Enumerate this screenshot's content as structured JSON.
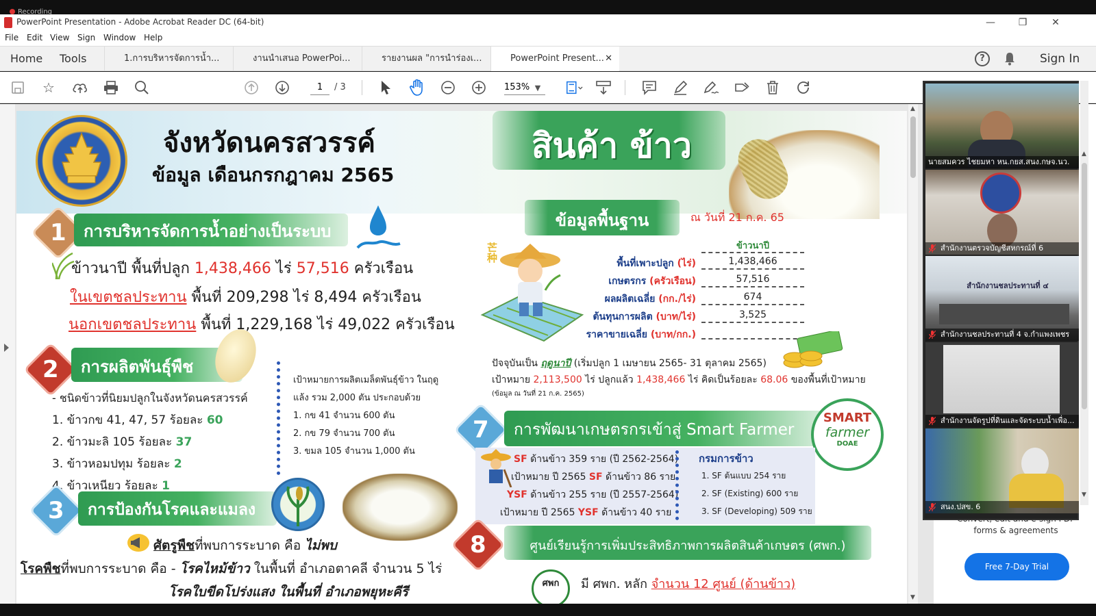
{
  "recording": "Recording",
  "window": {
    "title": "PowerPoint Presentation - Adobe Acrobat Reader DC (64-bit)",
    "minimize": "—",
    "restore": "❐",
    "close": "✕"
  },
  "menu": [
    "File",
    "Edit",
    "View",
    "Sign",
    "Window",
    "Help"
  ],
  "nav": {
    "home": "Home",
    "tools": "Tools",
    "sign_in": "Sign In",
    "help": "?"
  },
  "tabs": [
    {
      "label": "1.การบริหารจัดการน้ำ..."
    },
    {
      "label": "งานนำเสนอ PowerPoi..."
    },
    {
      "label": "รายงานผล \"การนำร่องเ..."
    },
    {
      "label": "PowerPoint Present...",
      "close": "✕"
    }
  ],
  "toolbar": {
    "page_current": "1",
    "page_total": "/ 3",
    "zoom": "153%"
  },
  "icons": {
    "save": "save-icon",
    "bookmark": "star-icon",
    "upload": "upload-icon",
    "print": "print-icon",
    "search": "search-icon",
    "prev": "prev-page-icon",
    "next": "next-page-icon",
    "select": "cursor-icon",
    "hand": "hand-icon",
    "zoom_out": "zoom-out-icon",
    "zoom_in": "zoom-in-icon",
    "fit": "fit-page-icon",
    "scroll": "scroll-mode-icon",
    "comment": "comment-icon",
    "highlight": "pen-icon",
    "sign": "sign-icon",
    "stamp": "stamp-icon",
    "delete": "trash-icon",
    "rotate": "rotate-icon"
  },
  "slide": {
    "province": "จังหวัดนครสวรรค์",
    "data_month": "ข้อมูล เดือนกรกฎาคม 2565",
    "product_title": "สินค้า  ข้าว",
    "sec1": {
      "num": "1",
      "title": "การบริหารจัดการน้ำอย่างเป็นระบบ",
      "line1_a": "ข้าวนาปี พื้นที่ปลูก ",
      "line1_b": "1,438,466",
      "line1_c": " ไร่ ",
      "line1_d": "57,516",
      "line1_e": " ครัวเรือน",
      "line2_a": "ในเขตชลประทาน",
      "line2_b": " พื้นที่ 209,298 ไร่ 8,494 ครัวเรือน",
      "line3_a": "นอกเขตชลประทาน",
      "line3_b": " พื้นที่ 1,229,168 ไร่ 49,022 ครัวเรือน"
    },
    "sec2": {
      "num": "2",
      "title": "การผลิตพันธุ์พืช",
      "intro": "- ชนิดข้าวที่นิยมปลูกในจังหวัดนครสวรรค์",
      "items": [
        {
          "label": "1. ข้าวกข 41, 47, 57  ร้อยละ ",
          "pct": "60"
        },
        {
          "label": "2. ข้าวมะลิ 105      ร้อยละ ",
          "pct": "37"
        },
        {
          "label": "3. ข้าวหอมปทุม      ร้อยละ ",
          "pct": "2"
        },
        {
          "label": "4. ข้าวเหนียว  ร้อยละ ",
          "pct": "1"
        }
      ],
      "target_l1": "เป้าหมายการผลิตเมล็ดพันธุ์ข้าว ในฤดู",
      "target_l2": "แล้ง รวม 2,000 ตัน ประกอบด้วย",
      "target_items": [
        "1. กข 41 จำนวน 600 ตัน",
        "2. กข 79 จำนวน  700 ตัน",
        "3. ขมล 105 จำนวน 1,000 ตัน"
      ]
    },
    "sec3": {
      "num": "3",
      "title": "การป้องกันโรคและแมลง",
      "pest_a": "ศัตรูพืช",
      "pest_b": "ที่พบการระบาด คือ ",
      "pest_c": "ไม่พบ",
      "disease_a": "โรคพืช",
      "disease_b": "ที่พบการระบาด คือ - ",
      "disease_c": "โรคไหม้ข้าว",
      "disease_d": " ในพื้นที่ อำเภอตาคลี จำนวน 5 ไร่",
      "disease2": "โรคใบขีดโปร่งแสง ในพื้นที่ อำเภอพยุหะคีรี"
    },
    "basic": {
      "title": "ข้อมูลพื้นฐาน",
      "as_of": "ณ วันที่ 21 ก.ค. 65",
      "col_header": "ข้าวนาปี",
      "rows": [
        {
          "a": "พื้นที่เพาะปลูก ",
          "u": "(ไร่)",
          "value": "1,438,466"
        },
        {
          "a": "เกษตรกร ",
          "u": "(ครัวเรือน)",
          "value": "57,516"
        },
        {
          "a": "ผลผลิตเฉลี่ย ",
          "u": "(กก./ไร่)",
          "value": "674"
        },
        {
          "a": "ต้นทุนการผลิต ",
          "u": "(บาท/ไร่)",
          "value": "3,525"
        },
        {
          "a": "ราคาขายเฉลี่ย ",
          "u": "(บาท/กก.)",
          "value": ""
        }
      ],
      "season_a": "ปัจจุบันเป็น ",
      "season_b": "ฤดูนาปี",
      "season_c": " (เริ่มปลูก 1 เมษายน 2565- 31 ตุลาคม 2565)",
      "target_a": "เป้าหมาย ",
      "target_b": "2,113,500",
      "target_c": " ไร่  ปลูกแล้ว ",
      "target_d": "1,438,466",
      "target_e": " ไร่ คิดเป็นร้อยละ ",
      "target_f": "68.06",
      "target_g": " ของพื้นที่เป้าหมาย",
      "source": "(ข้อมูล ณ วันที่ 21 ก.ค. 2565)"
    },
    "sec7": {
      "num": "7",
      "title": "การพัฒนาเกษตรกรเข้าสู่ Smart Farmer",
      "badge_a": "SMART",
      "badge_b": "farmer",
      "badge_c": "DOAE",
      "l1_a": "SF",
      "l1_b": " ด้านข้าว 359 ราย (ปี 2562-2564)",
      "l2_a": "เป้าหมาย ปี 2565 ",
      "l2_b": "SF",
      "l2_c": " ด้านข้าว 86 ราย",
      "l3_a": "YSF",
      "l3_b": " ด้านข้าว 255 ราย (ปี 2557-2564)",
      "l4_a": "เป้าหมาย ปี 2565 ",
      "l4_b": "YSF",
      "l4_c": " ด้านข้าว 40 ราย",
      "dept": "กรมการข้าว",
      "dept_items": [
        "1. SF ต้นแบบ 254 ราย",
        "2. SF (Existing) 600 ราย",
        "3. SF (Developing) 509 ราย"
      ]
    },
    "sec8": {
      "num": "8",
      "title": "ศูนย์เรียนรู้การเพิ่มประสิทธิภาพการผลิตสินค้าเกษตร (ศพก.)",
      "logo": "ศพก",
      "line_a": "มี ศพก. หลัก ",
      "line_b": "จำนวน 12 ศูนย์  (ด้านข้าว)"
    },
    "farmer_icon": "芒种"
  },
  "videos": [
    {
      "name": "นายสมควร ไชยมหา หน.กยส.สนง.กษจ.นว."
    },
    {
      "name": "สำนักงานตรวจบัญชีสหกรณ์ที่ 6"
    },
    {
      "name": "สำนักงานชลประทานที่ 4 จ.กำแพงเพชร",
      "sign": "สำนักงานชลประทานที่ ๔"
    },
    {
      "name": "สำนักงานจัดรูปที่ดินและจัดระบบน้ำเพื่อ..."
    },
    {
      "name": "สนง.ปสข. 6"
    }
  ],
  "promo": {
    "line1": "Convert, edit and e-sign PDF",
    "line2": "forms & agreements",
    "trial": "Free 7-Day Trial"
  },
  "colors": {
    "accent": "#1473e6",
    "green": "#3aa35a",
    "red": "#e0322d"
  }
}
